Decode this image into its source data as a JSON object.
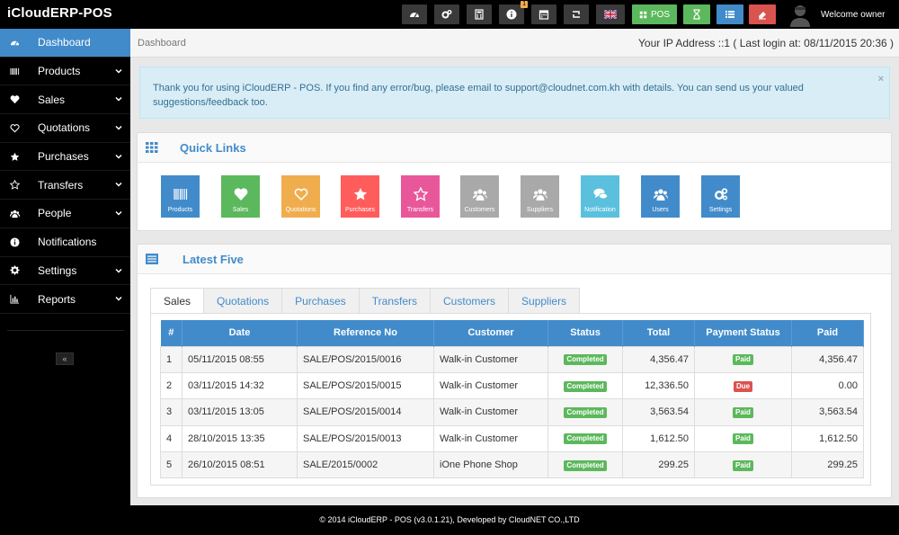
{
  "app": {
    "title": "iCloudERP-POS",
    "welcome": "Welcome owner"
  },
  "toolbar": {
    "notification_count": "1",
    "pos_label": "POS"
  },
  "sidebar": {
    "items": [
      {
        "label": "Dashboard",
        "icon": "dashboard-icon"
      },
      {
        "label": "Products",
        "icon": "barcode-icon"
      },
      {
        "label": "Sales",
        "icon": "heart-icon"
      },
      {
        "label": "Quotations",
        "icon": "heart-outline-icon"
      },
      {
        "label": "Purchases",
        "icon": "star-icon"
      },
      {
        "label": "Transfers",
        "icon": "star-outline-icon"
      },
      {
        "label": "People",
        "icon": "users-icon"
      },
      {
        "label": "Notifications",
        "icon": "info-icon"
      },
      {
        "label": "Settings",
        "icon": "cog-icon"
      },
      {
        "label": "Reports",
        "icon": "bar-chart-icon"
      }
    ],
    "collapse": "«"
  },
  "breadcrumb": "Dashboard",
  "ipinfo": "Your IP Address ::1 ( Last login at: 08/11/2015 20:36 )",
  "alert": {
    "text": "Thank you for using iCloudERP - POS. If you find any error/bug, please email to support@cloudnet.com.kh with details. You can send us your valued suggestions/feedback too.",
    "close": "×"
  },
  "quick_links": {
    "title": "Quick Links",
    "items": [
      {
        "label": "Products",
        "color": "#428bca"
      },
      {
        "label": "Sales",
        "color": "#5cb85c"
      },
      {
        "label": "Quotations",
        "color": "#f0ad4e"
      },
      {
        "label": "Purchases",
        "color": "#ff5c5c"
      },
      {
        "label": "Transfers",
        "color": "#e9579b"
      },
      {
        "label": "Customers",
        "color": "#a9a9a9"
      },
      {
        "label": "Suppliers",
        "color": "#a9a9a9"
      },
      {
        "label": "Notification",
        "color": "#5bc0de"
      },
      {
        "label": "Users",
        "color": "#428bca"
      },
      {
        "label": "Settings",
        "color": "#428bca"
      }
    ]
  },
  "latest": {
    "title": "Latest Five",
    "tabs": [
      "Sales",
      "Quotations",
      "Purchases",
      "Transfers",
      "Customers",
      "Suppliers"
    ],
    "columns": [
      "#",
      "Date",
      "Reference No",
      "Customer",
      "Status",
      "Total",
      "Payment Status",
      "Paid"
    ],
    "rows": [
      [
        "1",
        "05/11/2015 08:55",
        "SALE/POS/2015/0016",
        "Walk-in Customer",
        "Completed",
        "4,356.47",
        "Paid",
        "4,356.47"
      ],
      [
        "2",
        "03/11/2015 14:32",
        "SALE/POS/2015/0015",
        "Walk-in Customer",
        "Completed",
        "12,336.50",
        "Due",
        "0.00"
      ],
      [
        "3",
        "03/11/2015 13:05",
        "SALE/POS/2015/0014",
        "Walk-in Customer",
        "Completed",
        "3,563.54",
        "Paid",
        "3,563.54"
      ],
      [
        "4",
        "28/10/2015 13:35",
        "SALE/POS/2015/0013",
        "Walk-in Customer",
        "Completed",
        "1,612.50",
        "Paid",
        "1,612.50"
      ],
      [
        "5",
        "26/10/2015 08:51",
        "SALE/2015/0002",
        "iOne Phone Shop",
        "Completed",
        "299.25",
        "Paid",
        "299.25"
      ]
    ]
  },
  "footer": "© 2014 iCloudERP - POS (v3.0.1.21), Developed by CloudNET CO.,LTD"
}
